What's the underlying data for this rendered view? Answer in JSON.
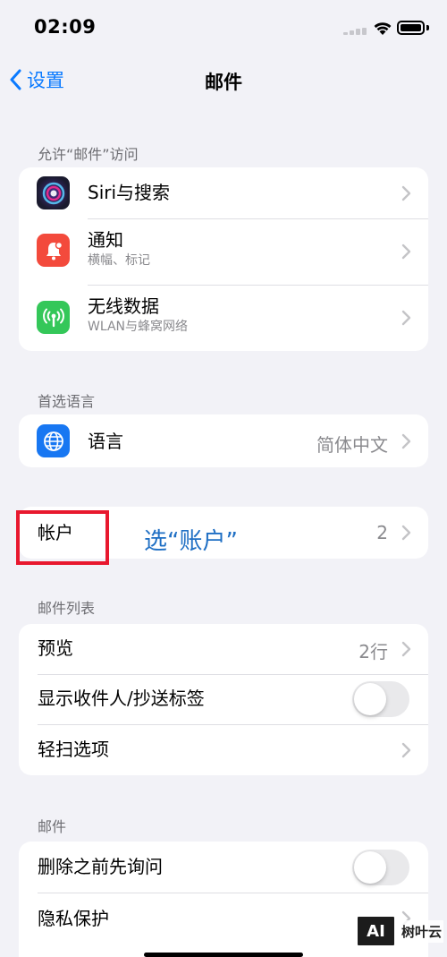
{
  "status_bar": {
    "time": "02:09"
  },
  "nav": {
    "back_label": "设置",
    "title": "邮件"
  },
  "allow_access": {
    "header": "允许“邮件”访问",
    "items": [
      {
        "title": "Siri与搜索",
        "subtitle": "",
        "icon": "siri-icon"
      },
      {
        "title": "通知",
        "subtitle": "横幅、标记",
        "icon": "notifications-icon"
      },
      {
        "title": "无线数据",
        "subtitle": "WLAN与蜂窝网络",
        "icon": "antenna-icon"
      }
    ]
  },
  "preferred_language": {
    "header": "首选语言",
    "item": {
      "title": "语言",
      "value": "简体中文",
      "icon": "globe-icon"
    }
  },
  "accounts": {
    "title": "帐户",
    "value": "2"
  },
  "annotation": {
    "text": "选“账户”",
    "box_color": "#e8182e",
    "text_color": "#1f6fc4"
  },
  "message_list": {
    "header": "邮件列表",
    "items": [
      {
        "title": "预览",
        "value": "2行",
        "type": "link"
      },
      {
        "title": "显示收件人/抄送标签",
        "type": "toggle",
        "on": false
      },
      {
        "title": "轻扫选项",
        "type": "link"
      }
    ]
  },
  "messages": {
    "header": "邮件",
    "items": [
      {
        "title": "删除之前先询问",
        "type": "toggle",
        "on": false
      },
      {
        "title": "隐私保护",
        "type": "link"
      }
    ]
  },
  "watermark": {
    "logo": "AI",
    "text": "树叶云"
  },
  "colors": {
    "accent": "#0a7aff",
    "background": "#f2f2f7",
    "notification_red": "#f34a3c",
    "cellular_green": "#34c759",
    "language_blue": "#1877f2"
  }
}
